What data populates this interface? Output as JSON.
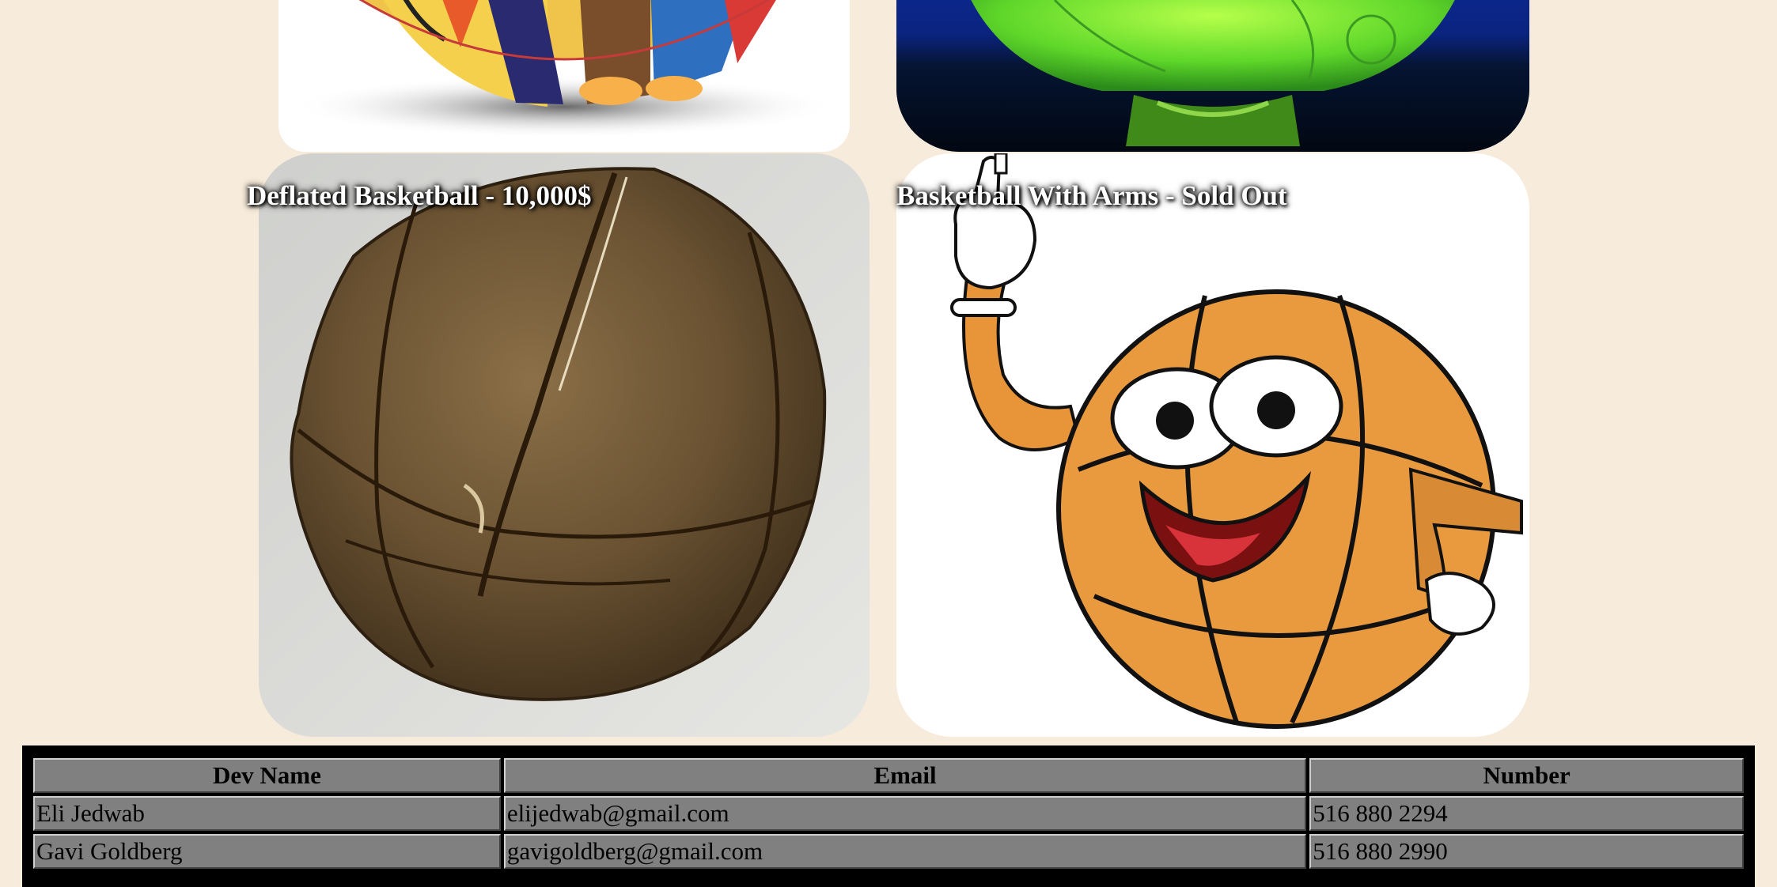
{
  "products": {
    "deflated": {
      "caption": "Deflated Basketball - 10,000$"
    },
    "arms": {
      "caption": "Basketball With Arms - Sold Out"
    }
  },
  "dev_table": {
    "headers": [
      "Dev Name",
      "Email",
      "Number"
    ],
    "rows": [
      [
        "Eli Jedwab",
        "elijedwab@gmail.com",
        "516 880 2294"
      ],
      [
        "Gavi Goldberg",
        "gavigoldberg@gmail.com",
        "516 880 2990"
      ]
    ]
  },
  "colors": {
    "page_background": "#f7ebdb",
    "table_border": "#000000",
    "table_cell": "#808080",
    "caption_text": "#ffffff"
  }
}
